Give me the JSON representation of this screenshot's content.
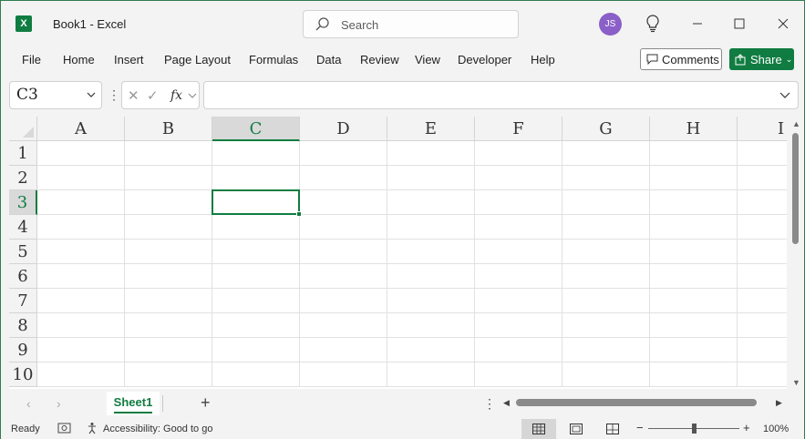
{
  "window": {
    "doc_title": "Book1  -  Excel",
    "app_icon_letter": "X"
  },
  "search": {
    "placeholder": "Search"
  },
  "user": {
    "initials": "JS"
  },
  "ribbon": {
    "tabs": [
      "File",
      "Home",
      "Insert",
      "Page Layout",
      "Formulas",
      "Data",
      "Review",
      "View",
      "Developer",
      "Help"
    ],
    "comments_label": "Comments",
    "share_label": "Share"
  },
  "formula_bar": {
    "name_box": "C3",
    "fx_label": "fx",
    "value": ""
  },
  "grid": {
    "columns": [
      "A",
      "B",
      "C",
      "D",
      "E",
      "F",
      "G",
      "H",
      "I"
    ],
    "rows": [
      "1",
      "2",
      "3",
      "4",
      "5",
      "6",
      "7",
      "8",
      "9",
      "10"
    ],
    "selected_column": "C",
    "selected_row": "3"
  },
  "sheets": {
    "tabs": [
      "Sheet1"
    ],
    "active": "Sheet1"
  },
  "status": {
    "ready": "Ready",
    "accessibility": "Accessibility: Good to go",
    "zoom": "100%",
    "zoom_fraction": 0.5
  },
  "colors": {
    "accent": "#107c41",
    "avatar": "#8a5fc7"
  },
  "icons": [
    "excel-app-icon",
    "search-icon",
    "lightbulb-icon",
    "minimize-icon",
    "maximize-icon",
    "close-icon",
    "comment-icon",
    "share-icon",
    "cancel-icon",
    "enter-icon",
    "add-sheet-icon"
  ]
}
